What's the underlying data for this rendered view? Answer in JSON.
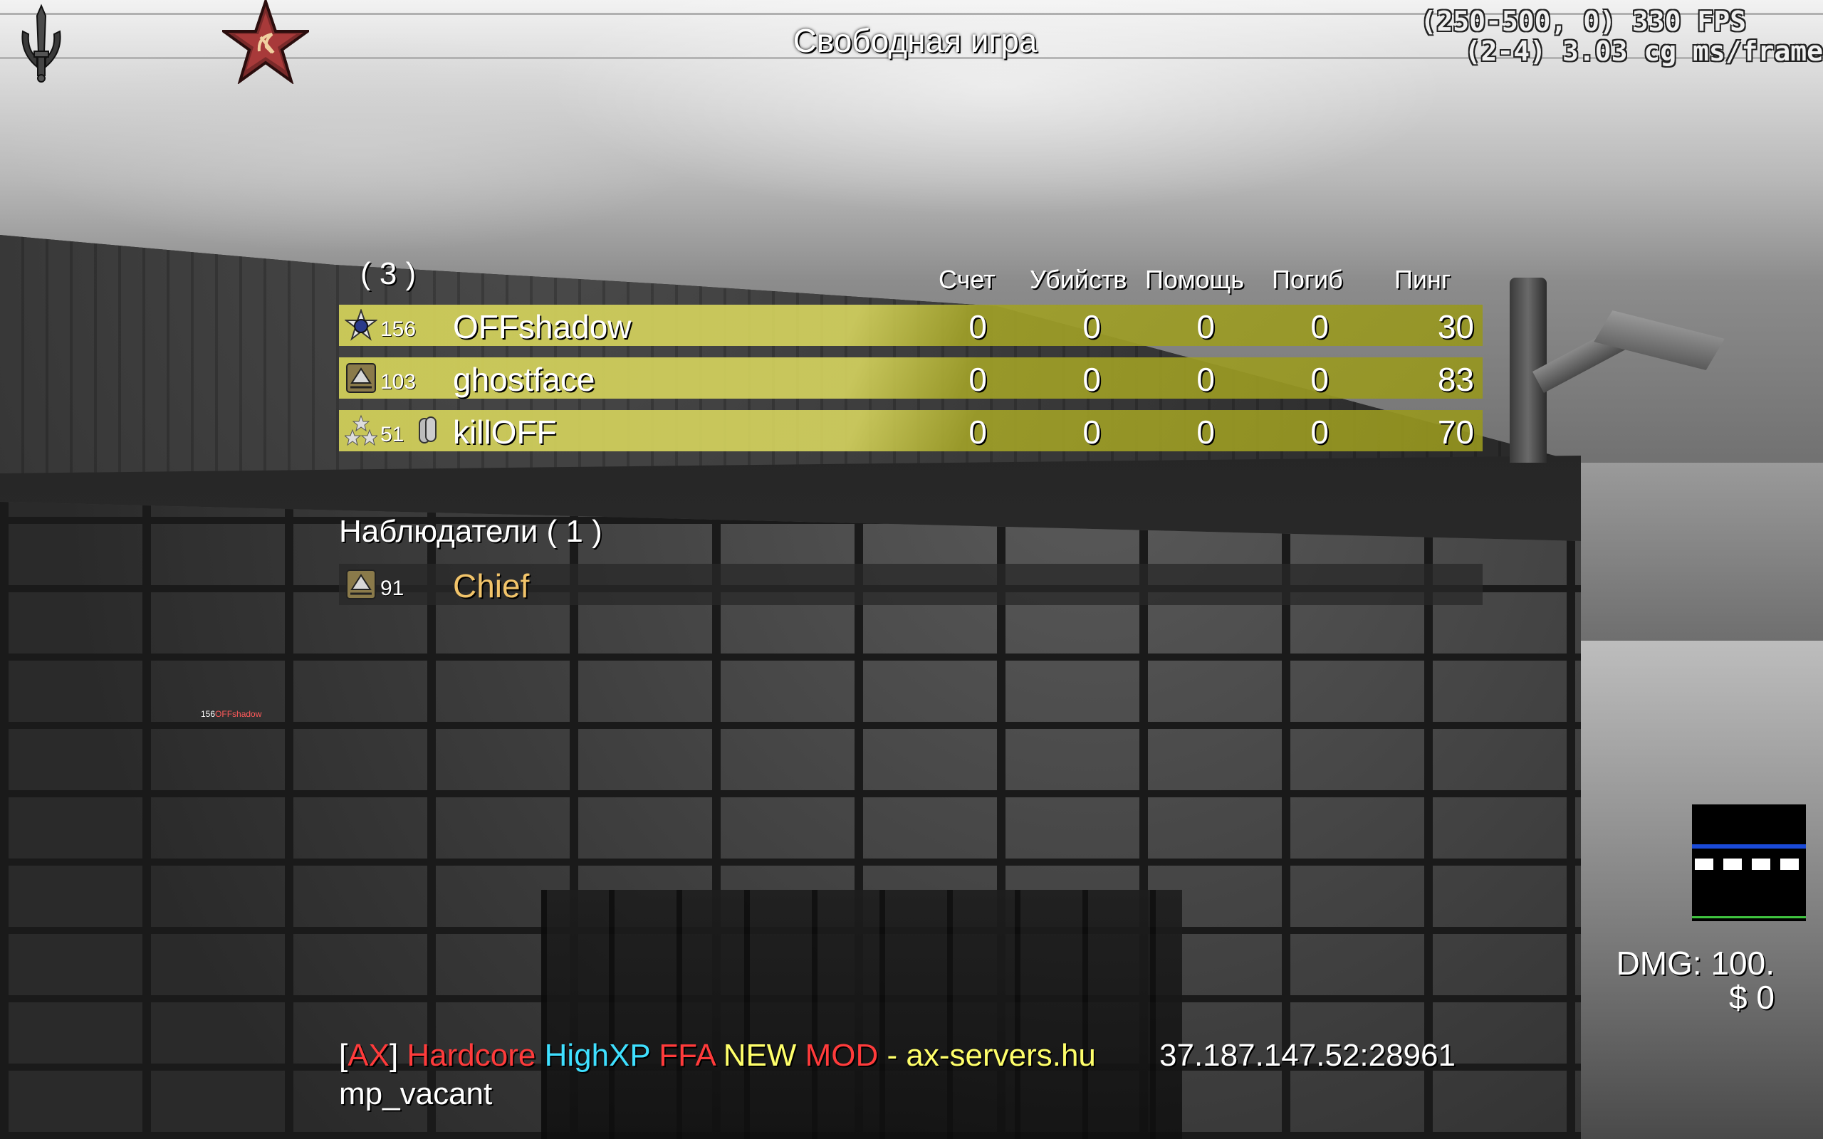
{
  "hud": {
    "gametype": "Свободная игра",
    "fps_line": "(250-500, 0) 330 FPS",
    "frametime_line": "(2-4) 3.03 cg ms/frame",
    "dmg": "DMG: 100.",
    "money": "$ 0"
  },
  "scoreboard": {
    "team_count": "( 3 )",
    "headers": {
      "score": "Счет",
      "kills": "Убийств",
      "assists": "Помощь",
      "deaths": "Погиб",
      "ping": "Пинг"
    },
    "players": [
      {
        "rank": "156",
        "name": "OFFshadow",
        "score": "0",
        "kills": "0",
        "assists": "0",
        "deaths": "0",
        "ping": "30"
      },
      {
        "rank": "103",
        "name": "ghostface",
        "score": "0",
        "kills": "0",
        "assists": "0",
        "deaths": "0",
        "ping": "83"
      },
      {
        "rank": "51",
        "name": "killOFF",
        "score": "0",
        "kills": "0",
        "assists": "0",
        "deaths": "0",
        "ping": "70"
      }
    ],
    "spectators_label": "Наблюдатели ( 1 )",
    "spectators": [
      {
        "rank": "91",
        "name": "Chief"
      }
    ]
  },
  "overhead_tag": {
    "rank": "156",
    "name": "OFFshadow"
  },
  "server": {
    "name_parts": [
      {
        "text": "[",
        "color": "#ffffff"
      },
      {
        "text": "AX",
        "color": "#ff3b3b"
      },
      {
        "text": "] ",
        "color": "#ffffff"
      },
      {
        "text": "Hardcore ",
        "color": "#ff3b3b"
      },
      {
        "text": "HighXP ",
        "color": "#3fe0ff"
      },
      {
        "text": "FFA ",
        "color": "#ff3b3b"
      },
      {
        "text": "NEW ",
        "color": "#ffff6a"
      },
      {
        "text": "MOD ",
        "color": "#ff3b3b"
      },
      {
        "text": "- ",
        "color": "#ffff6a"
      },
      {
        "text": "ax-servers.hu",
        "color": "#ffff6a"
      }
    ],
    "address": "37.187.147.52:28961",
    "map": "mp_vacant"
  },
  "icons": {
    "faction": "dagger-emblem-icon",
    "team": "red-star-hammer-sickle-icon"
  }
}
